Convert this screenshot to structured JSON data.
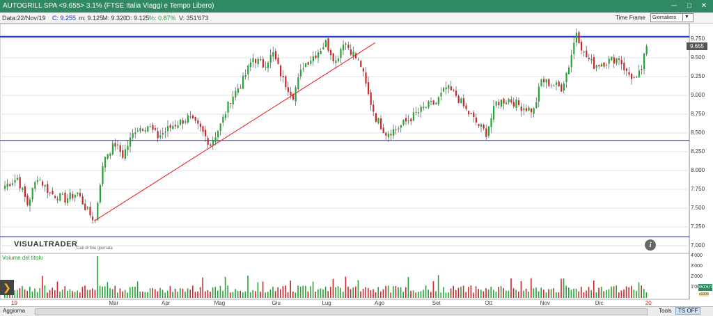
{
  "window": {
    "title": "AUTOGRILL SPA <9.655> 3.1% (FTSE Italia Viaggi e Tempo Libero)",
    "min_label": "─",
    "max_label": "□",
    "close_label": "✕"
  },
  "info": {
    "date": "Data:22/Nov/19",
    "close": "C: 9.255",
    "min": "m: 9.125",
    "max": "M: 9.320",
    "open": "O: 9.125",
    "pct": "%: 0.87%",
    "volume": "V: 351'673"
  },
  "timeframe": {
    "label": "Time Frame",
    "selected": "Giornaliero",
    "arrow": "▼"
  },
  "branding": {
    "logo": "VISUALTRADER",
    "subtitle": "Dati di fine giornata"
  },
  "info_icon": "i",
  "volume_panel": {
    "label": "Volume del titolo",
    "tag": "351'673",
    "multiplier": "x1000"
  },
  "side_arrow": "❯",
  "bottombar": {
    "refresh": "Aggiorna",
    "tools": "Tools",
    "ts": "TS OFF"
  },
  "colors": {
    "up": "#25a535",
    "down": "#c9282c",
    "trendline": "#e8333a",
    "hline": "#1a2fc0",
    "titlebar": "#2f8a62"
  },
  "chart_data": {
    "type": "candlestick",
    "y_ticks": [
      "9.750",
      "9.500",
      "9.250",
      "9.000",
      "8.750",
      "8.500",
      "8.250",
      "8.000",
      "7.750",
      "7.500",
      "7.250",
      "7.000"
    ],
    "y_range": [
      7.0,
      9.75
    ],
    "volume_ticks": [
      "4'000",
      "3'000",
      "2'000",
      "1'000"
    ],
    "volume_range": [
      0,
      4000
    ],
    "x_labels": [
      {
        "label": "19",
        "year": true,
        "index": 0
      },
      {
        "label": "Mar",
        "year": false,
        "index": 39
      },
      {
        "label": "Apr",
        "year": false,
        "index": 60
      },
      {
        "label": "Mag",
        "year": false,
        "index": 81
      },
      {
        "label": "Giu",
        "year": false,
        "index": 104
      },
      {
        "label": "Lug",
        "year": false,
        "index": 124
      },
      {
        "label": "Ago",
        "year": false,
        "index": 145
      },
      {
        "label": "Set",
        "year": false,
        "index": 168
      },
      {
        "label": "Ott",
        "year": false,
        "index": 189
      },
      {
        "label": "Nov",
        "year": false,
        "index": 211
      },
      {
        "label": "Dic",
        "year": false,
        "index": 233
      },
      {
        "label": "20",
        "year": true,
        "index": 253
      }
    ],
    "last_price": "9.655",
    "horizontal_levels": [
      9.78,
      8.4,
      7.12
    ],
    "trendline": {
      "start": {
        "index": 36,
        "value": 7.33
      },
      "end": {
        "index": 148,
        "value": 9.7
      }
    },
    "close_path": [
      [
        0,
        7.8
      ],
      [
        5,
        7.9
      ],
      [
        9,
        7.55
      ],
      [
        13,
        7.92
      ],
      [
        18,
        7.7
      ],
      [
        24,
        7.62
      ],
      [
        29,
        7.7
      ],
      [
        33,
        7.45
      ],
      [
        36,
        7.33
      ],
      [
        38,
        7.85
      ],
      [
        40,
        8.2
      ],
      [
        44,
        8.35
      ],
      [
        47,
        8.2
      ],
      [
        52,
        8.55
      ],
      [
        57,
        8.6
      ],
      [
        61,
        8.45
      ],
      [
        67,
        8.6
      ],
      [
        73,
        8.7
      ],
      [
        78,
        8.55
      ],
      [
        82,
        8.35
      ],
      [
        86,
        8.6
      ],
      [
        90,
        8.95
      ],
      [
        95,
        9.2
      ],
      [
        99,
        9.5
      ],
      [
        103,
        9.4
      ],
      [
        107,
        9.55
      ],
      [
        111,
        9.2
      ],
      [
        115,
        9.0
      ],
      [
        119,
        9.4
      ],
      [
        124,
        9.55
      ],
      [
        128,
        9.7
      ],
      [
        132,
        9.45
      ],
      [
        135,
        9.72
      ],
      [
        138,
        9.6
      ],
      [
        142,
        9.4
      ],
      [
        145,
        9.0
      ],
      [
        148,
        8.7
      ],
      [
        152,
        8.5
      ],
      [
        156,
        8.55
      ],
      [
        162,
        8.7
      ],
      [
        168,
        8.85
      ],
      [
        172,
        8.9
      ],
      [
        176,
        9.1
      ],
      [
        180,
        9.0
      ],
      [
        184,
        8.8
      ],
      [
        189,
        8.6
      ],
      [
        192,
        8.5
      ],
      [
        196,
        8.9
      ],
      [
        201,
        8.95
      ],
      [
        206,
        8.85
      ],
      [
        211,
        8.8
      ],
      [
        214,
        9.2
      ],
      [
        218,
        9.15
      ],
      [
        222,
        9.1
      ],
      [
        225,
        9.4
      ],
      [
        228,
        9.85
      ],
      [
        231,
        9.55
      ],
      [
        235,
        9.4
      ],
      [
        240,
        9.45
      ],
      [
        245,
        9.5
      ],
      [
        248,
        9.3
      ],
      [
        252,
        9.2
      ],
      [
        254,
        9.35
      ],
      [
        256,
        9.655
      ]
    ]
  }
}
